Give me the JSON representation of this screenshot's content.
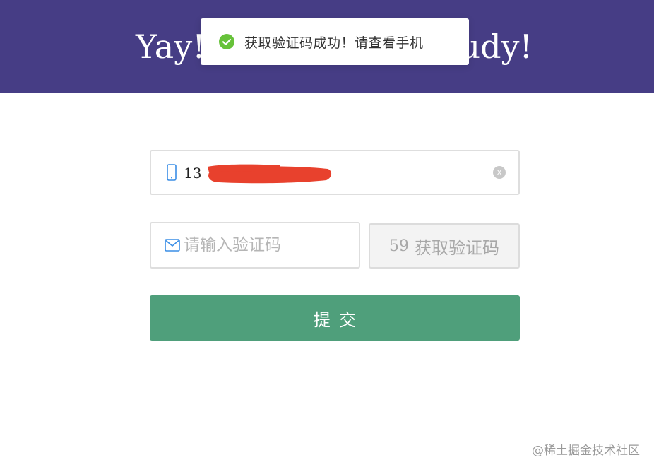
{
  "header": {
    "title_left": "Yay!",
    "title_right": "udy!",
    "background_color": "#463d85"
  },
  "toast": {
    "icon": "check-circle-icon",
    "message": "获取验证码成功！请查看手机",
    "icon_color": "#67c23a"
  },
  "form": {
    "phone": {
      "icon": "mobile-phone-icon",
      "value": "13",
      "clear_icon": "clear-icon",
      "clear_label": "x"
    },
    "code": {
      "icon": "mail-icon",
      "value": "",
      "placeholder": "请输入验证码"
    },
    "get_code_button": {
      "countdown": "59",
      "label": "获取验证码"
    },
    "submit_label": "提交",
    "submit_color": "#4f9f7b"
  },
  "watermark": "@稀土掘金技术社区"
}
